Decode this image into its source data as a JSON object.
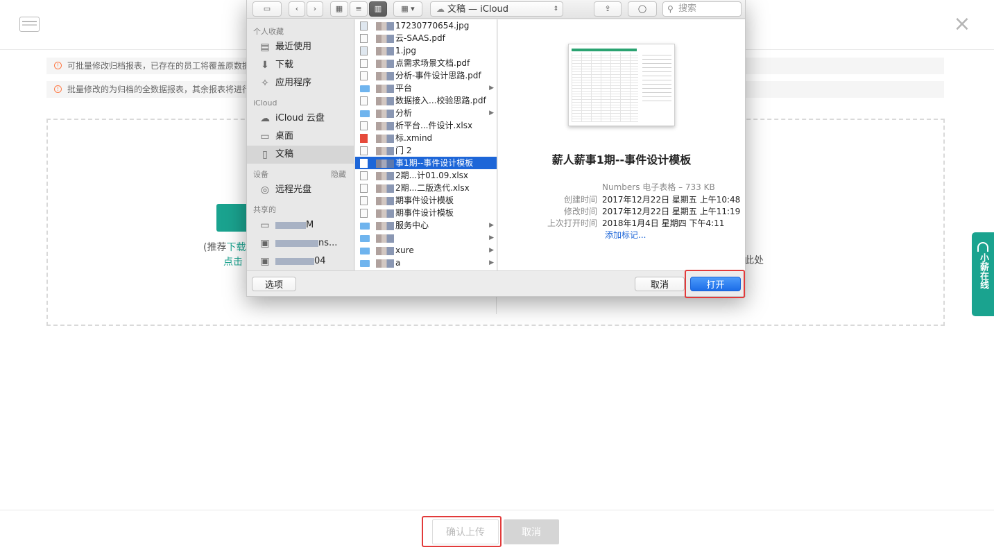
{
  "page": {
    "notice_1": "可批量修改归档报表，已存在的员工将覆盖原数据",
    "notice_2": "批量修改的为归档的全数据报表，其余报表将进行",
    "dropzone": {
      "left_line_prefix": "(推荐",
      "left_line_link": "下载",
      "left_line_2": "点击",
      "right_text": "此处"
    },
    "chat_float": "小薪在线",
    "buttons": {
      "confirm": "确认上传",
      "cancel": "取消"
    }
  },
  "dialog": {
    "path": "文稿 — iCloud",
    "search_placeholder": "搜索",
    "sidebar": {
      "favorites_header": "个人收藏",
      "favorites": [
        {
          "label": "最近使用",
          "icon": "recents-icon"
        },
        {
          "label": "下载",
          "icon": "downloads-icon"
        },
        {
          "label": "应用程序",
          "icon": "applications-icon"
        }
      ],
      "icloud_header": "iCloud",
      "icloud": [
        {
          "label": "iCloud 云盘",
          "icon": "cloud-icon"
        },
        {
          "label": "桌面",
          "icon": "desktop-icon"
        },
        {
          "label": "文稿",
          "icon": "documents-icon"
        }
      ],
      "devices_header": "设备",
      "devices_hide": "隐藏",
      "devices": [
        {
          "label": "远程光盘",
          "icon": "disc-icon"
        }
      ],
      "shared_header": "共享的",
      "shared": [
        {
          "label": "M",
          "icon": "laptop-icon"
        },
        {
          "label": "ns...",
          "icon": "monitor-icon"
        },
        {
          "label": "04",
          "icon": "monitor-icon"
        }
      ]
    },
    "files": [
      {
        "name": "17230770654.jpg",
        "type": "img"
      },
      {
        "name": "云-SAAS.pdf",
        "type": "doc"
      },
      {
        "name": "1.jpg",
        "type": "img"
      },
      {
        "name": "点需求场景文档.pdf",
        "type": "doc"
      },
      {
        "name": "分析-事件设计思路.pdf",
        "type": "doc"
      },
      {
        "name": "平台",
        "type": "folder"
      },
      {
        "name": "数据接入...校验思路.pdf",
        "type": "doc"
      },
      {
        "name": "分析",
        "type": "folder"
      },
      {
        "name": "析平台...件设计.xlsx",
        "type": "doc"
      },
      {
        "name": "标.xmind",
        "type": "xmind"
      },
      {
        "name": "门 2",
        "type": "doc"
      },
      {
        "name": "事1期--事件设计模板",
        "type": "doc",
        "selected": true
      },
      {
        "name": "2期...计01.09.xlsx",
        "type": "doc"
      },
      {
        "name": "2期...二版迭代.xlsx",
        "type": "doc"
      },
      {
        "name": "期事件设计模板",
        "type": "doc"
      },
      {
        "name": "期事件设计模板",
        "type": "doc"
      },
      {
        "name": "服务中心",
        "type": "folder"
      },
      {
        "name": "",
        "type": "folder"
      },
      {
        "name": "xure",
        "type": "folder"
      },
      {
        "name": "a",
        "type": "folder"
      }
    ],
    "preview": {
      "title": "薪人薪事1期--事件设计模板",
      "kind": "Numbers 电子表格 – 733 KB",
      "created_label": "创建时间",
      "created_value": "2017年12月22日 星期五 上午10:48",
      "modified_label": "修改时间",
      "modified_value": "2017年12月22日 星期五 上午11:19",
      "opened_label": "上次打开时间",
      "opened_value": "2018年1月4日 星期四 下午4:11",
      "add_tags": "添加标记..."
    },
    "footer": {
      "options": "选项",
      "cancel": "取消",
      "open": "打开"
    }
  },
  "colors": {
    "brand_green": "#1aa38f",
    "mac_selection_blue": "#1d66d8",
    "highlight_red": "#e23a3a"
  }
}
